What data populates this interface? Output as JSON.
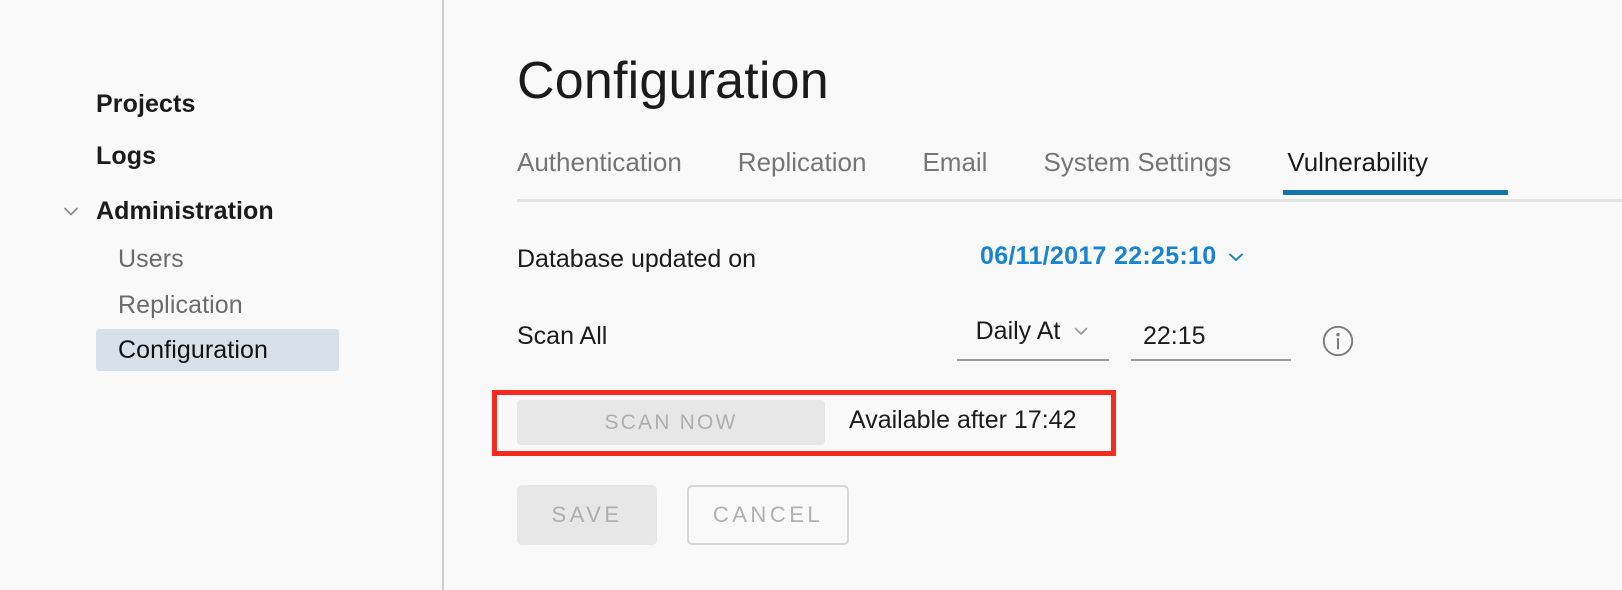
{
  "sidebar": {
    "items": [
      {
        "label": "Projects",
        "level": "top",
        "state": "default"
      },
      {
        "label": "Logs",
        "level": "top",
        "state": "default"
      },
      {
        "label": "Administration",
        "level": "parent",
        "state": "expanded",
        "icon": "chevron-down-icon"
      },
      {
        "label": "Users",
        "level": "child",
        "state": "default"
      },
      {
        "label": "Replication",
        "level": "child",
        "state": "default"
      },
      {
        "label": "Configuration",
        "level": "child",
        "state": "selected"
      }
    ],
    "selected_bg": "#d6e1e9"
  },
  "main": {
    "page_title": "Configuration",
    "tabs": [
      {
        "label": "Authentication",
        "active": false
      },
      {
        "label": "Replication",
        "active": false
      },
      {
        "label": "Email",
        "active": false
      },
      {
        "label": "System Settings",
        "active": false
      },
      {
        "label": "Vulnerability",
        "active": true
      }
    ],
    "active_tab_color": "#1376a8",
    "database_row": {
      "label": "Database updated on",
      "value": "06/11/2017 22:25:10",
      "value_color": "#1884d1",
      "caret_icon": "chevron-down-icon"
    },
    "scan_row": {
      "label": "Scan All",
      "schedule_select": {
        "value": "Daily At",
        "caret_icon": "chevron-down-icon"
      },
      "time_input": {
        "value": "22:15",
        "placeholder": "HH:MM"
      },
      "info_icon": "info-circle-icon"
    },
    "scan_now": {
      "button_label": "SCAN NOW",
      "disabled": true,
      "availability_text": "Available after 17:42",
      "annotation_border_color": "#f52a1e"
    },
    "actions": {
      "save_label": "SAVE",
      "save_disabled": true,
      "cancel_label": "CANCEL"
    }
  }
}
